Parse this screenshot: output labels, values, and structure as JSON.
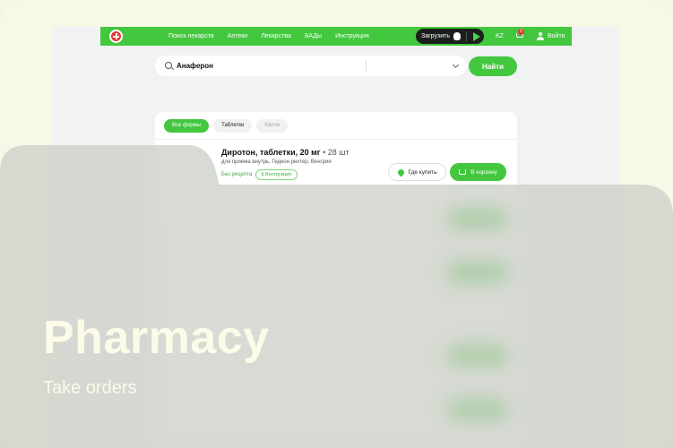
{
  "nav": {
    "links": [
      "Поиск лекарств",
      "Аптеки",
      "Лекарства",
      "БАДы",
      "Инструкция"
    ],
    "download_label": "Загрузить",
    "lang": "KZ",
    "cart_count": "2",
    "login_label": "Войти"
  },
  "search": {
    "query": "Анаферон",
    "button_label": "Найти"
  },
  "filters": [
    {
      "label": "Все формы",
      "state": "active"
    },
    {
      "label": "Таблетки",
      "state": "normal"
    },
    {
      "label": "Капли",
      "state": "disabled"
    }
  ],
  "product": {
    "name": "Диротон, таблетки, 20 мг",
    "qty": "• 28 шт",
    "description": "для приема внутрь, Гедеон рихтер, Венгрия",
    "rx": "Без рецепта",
    "instruction": "Инструкция",
    "where_label": "Где купить",
    "cart_label": "В корзину"
  },
  "overlay": {
    "title": "Pharmacy",
    "subtitle": "Take orders"
  },
  "colors": {
    "accent": "#43c73e",
    "overlay_text": "#fbfbe8"
  }
}
